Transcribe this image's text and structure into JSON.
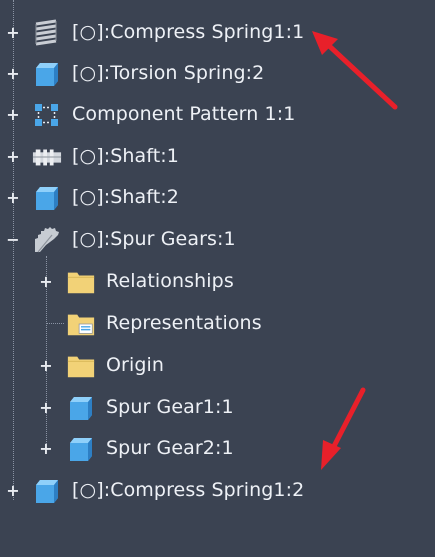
{
  "tree": {
    "root_items": [
      {
        "label": "[○]:Compress Spring1:1",
        "icon": "coil-spring-icon",
        "expand": "+"
      },
      {
        "label": "[○]:Torsion Spring:2",
        "icon": "part-cube-icon",
        "expand": "+"
      },
      {
        "label": "Component Pattern 1:1",
        "icon": "component-pattern-icon",
        "expand": "+"
      },
      {
        "label": "[○]:Shaft:1",
        "icon": "shaft-icon",
        "expand": "+"
      },
      {
        "label": "[○]:Shaft:2",
        "icon": "part-cube-icon",
        "expand": "+"
      },
      {
        "label": "[○]:Spur Gears:1",
        "icon": "spur-gear-icon",
        "expand": "−"
      }
    ],
    "child_items": [
      {
        "label": "Relationships",
        "icon": "folder-icon",
        "expand": "+"
      },
      {
        "label": "Representations",
        "icon": "representations-folder-icon",
        "expand": ""
      },
      {
        "label": "Origin",
        "icon": "folder-icon",
        "expand": "+"
      },
      {
        "label": "Spur Gear1:1",
        "icon": "part-cube-icon",
        "expand": "+"
      },
      {
        "label": "Spur Gear2:1",
        "icon": "part-cube-icon",
        "expand": "+"
      }
    ],
    "last_item": {
      "label": "[○]:Compress Spring1:2",
      "icon": "part-cube-icon",
      "expand": "+"
    }
  },
  "colors": {
    "background": "#3b4352",
    "text": "#eef1f6",
    "arrow": "#e8202a",
    "cube": "#4aa6e8",
    "folder": "#f2d277"
  }
}
